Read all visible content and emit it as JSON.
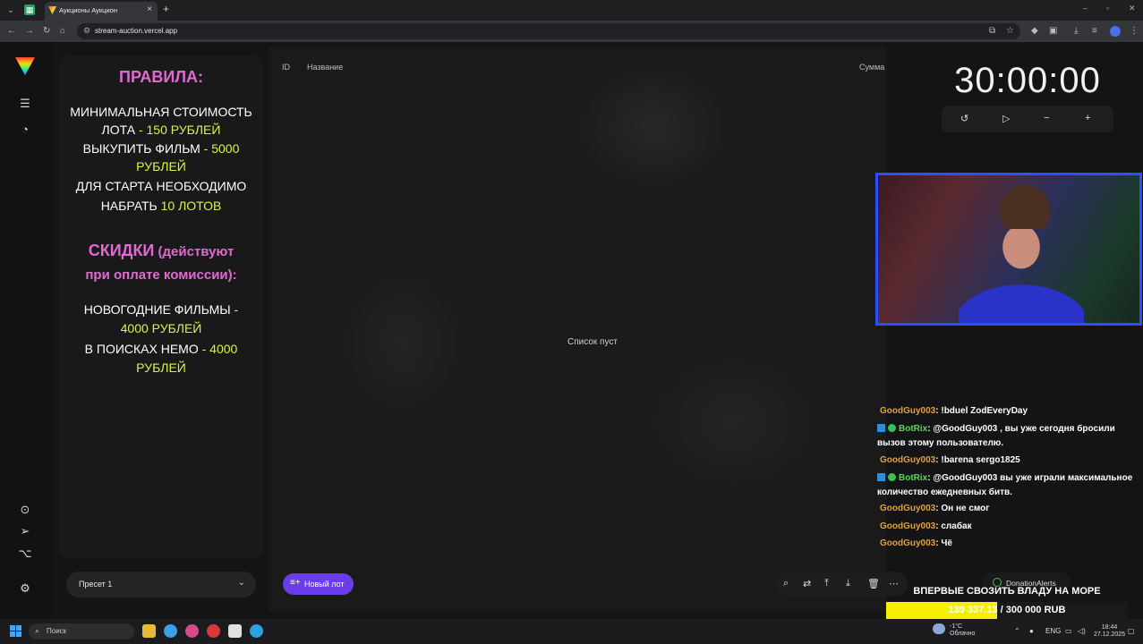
{
  "browser": {
    "tab_title": "Аукционы Аукцион",
    "url": "stream-auction.vercel.app"
  },
  "rules": {
    "title": "ПРАВИЛА:",
    "min_cost_a": "МИНИМАЛЬНАЯ СТОИМОСТЬ",
    "min_cost_b": "ЛОТА",
    "min_cost_value": " - 150 РУБЛЕЙ",
    "buyout_a": "ВЫКУПИТЬ ФИЛЬМ",
    "buyout_value_a": " - 5000",
    "buyout_value_b": "РУБЛЕЙ",
    "start_a": "ДЛЯ СТАРТА НЕОБХОДИМО",
    "start_b": "НАБРАТЬ",
    "start_value": " 10 ЛОТОВ",
    "discounts_title": "СКИДКИ",
    "discounts_note_a": " (действуют",
    "discounts_note_b": "при оплате комиссии):",
    "ny_a": "НОВОГОДНИЕ ФИЛЬМЫ",
    "ny_value_a": " -",
    "ny_value_b": "4000 РУБЛЕЙ",
    "nemo_a": "В ПОИСКАХ НЕМО",
    "nemo_value_a": " - 4000",
    "nemo_value_b": "РУБЛЕЙ"
  },
  "table": {
    "col_id": "ID",
    "col_name": "Название",
    "col_sum": "Сумма",
    "empty": "Список пуст"
  },
  "timer": {
    "value": "30:00:00"
  },
  "chat": [
    {
      "user": "GoodGuy003",
      "color": "orange",
      "text": ": !bduel ZodEveryDay"
    },
    {
      "user": "BotRix",
      "color": "green",
      "badges": true,
      "text": ": @GoodGuy003 , вы уже сегодня бросили",
      "text2": "вызов этому пользователю."
    },
    {
      "user": "GoodGuy003",
      "color": "orange",
      "text": ": !barena sergo1825"
    },
    {
      "user": "BotRix",
      "color": "green",
      "badges": true,
      "text": ": @GoodGuy003 вы уже играли максимальное",
      "text2": "количество ежедневных битв."
    },
    {
      "user": "GoodGuy003",
      "color": "orange",
      "text": ": Он не смог"
    },
    {
      "user": "GoodGuy003",
      "color": "orange",
      "text": ": слабак"
    },
    {
      "user": "GoodGuy003",
      "color": "orange",
      "text": ": Чё"
    }
  ],
  "bottom": {
    "preset_label": "Пресет 1",
    "new_lot_label": "Новый лот",
    "donation_label": "DonationAlerts"
  },
  "goal": {
    "title": "ВПЕРВЫЕ СВОЗИТЬ ВЛАДУ НА МОРЕ",
    "current": "139 337.13",
    "target": " / 300 000 RUB",
    "progress": 0.46
  },
  "taskbar": {
    "search_placeholder": "Поиск",
    "weather_temp": "-1°C",
    "weather_desc": "Облачно",
    "lang": "ENG",
    "time": "18:44",
    "date": "27.12.2025"
  }
}
